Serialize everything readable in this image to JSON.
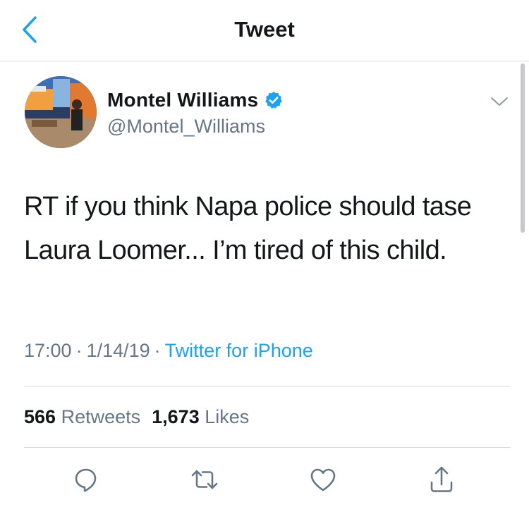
{
  "header": {
    "title": "Tweet",
    "back_icon": "chevron-left-icon"
  },
  "colors": {
    "brand_blue": "#1da1f2",
    "text_primary": "#14171a",
    "text_secondary": "#657786",
    "divider": "#dcdcdc"
  },
  "tweet": {
    "user": {
      "name": "Montel Williams",
      "handle": "@Montel_Williams",
      "verified": true
    },
    "text": "RT if you think Napa police should tase Laura Loomer... I’m tired of this child.",
    "time": "17:00",
    "date": "1/14/19",
    "separator": "·",
    "source": "Twitter for iPhone"
  },
  "stats": {
    "retweets_count": "566",
    "retweets_label": "Retweets",
    "likes_count": "1,673",
    "likes_label": "Likes"
  },
  "actions": [
    {
      "name": "reply",
      "icon": "comment-icon"
    },
    {
      "name": "retweet",
      "icon": "retweet-icon"
    },
    {
      "name": "like",
      "icon": "heart-icon"
    },
    {
      "name": "share",
      "icon": "share-icon"
    }
  ]
}
